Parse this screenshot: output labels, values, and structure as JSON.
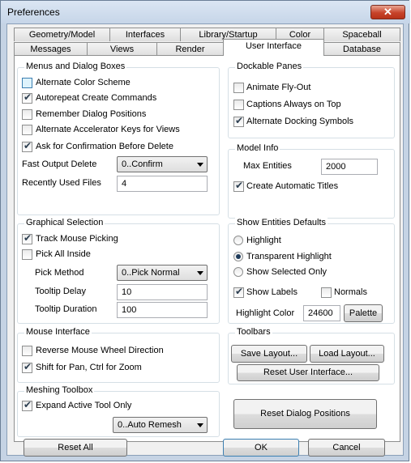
{
  "window": {
    "title": "Preferences",
    "close_label": "✕"
  },
  "tabs": {
    "row1": [
      "Geometry/Model",
      "Interfaces",
      "Library/Startup",
      "Color",
      "Spaceball"
    ],
    "row2": [
      "Messages",
      "Views",
      "Render",
      "User Interface",
      "Database"
    ],
    "active": "User Interface"
  },
  "menus": {
    "title": "Menus and Dialog Boxes",
    "alternate_color_scheme": "Alternate Color Scheme",
    "autorepeat": "Autorepeat Create Commands",
    "remember_positions": "Remember Dialog Positions",
    "alt_accel_keys": "Alternate Accelerator Keys for Views",
    "ask_confirm_delete": "Ask for Confirmation Before Delete",
    "fast_output_delete_label": "Fast Output Delete",
    "fast_output_delete_value": "0..Confirm",
    "recent_files_label": "Recently Used Files",
    "recent_files_value": "4"
  },
  "graphical": {
    "title": "Graphical Selection",
    "track_mouse": "Track Mouse Picking",
    "pick_all_inside": "Pick All Inside",
    "pick_method_label": "Pick Method",
    "pick_method_value": "0..Pick Normal",
    "tooltip_delay_label": "Tooltip Delay",
    "tooltip_delay_value": "10",
    "tooltip_duration_label": "Tooltip Duration",
    "tooltip_duration_value": "100"
  },
  "mouse": {
    "title": "Mouse Interface",
    "reverse_wheel": "Reverse Mouse Wheel Direction",
    "shift_pan": "Shift for Pan, Ctrl for Zoom"
  },
  "meshing": {
    "title": "Meshing Toolbox",
    "expand_active": "Expand Active Tool Only",
    "remesh_value": "0..Auto Remesh"
  },
  "dockable": {
    "title": "Dockable Panes",
    "animate": "Animate Fly-Out",
    "captions_top": "Captions Always on Top",
    "alt_docking": "Alternate Docking Symbols"
  },
  "model_info": {
    "title": "Model Info",
    "max_entities_label": "Max Entities",
    "max_entities_value": "2000",
    "create_titles": "Create Automatic Titles"
  },
  "show_entities": {
    "title": "Show Entities Defaults",
    "highlight": "Highlight",
    "transparent": "Transparent Highlight",
    "selected_only": "Show Selected Only",
    "show_labels": "Show Labels",
    "normals": "Normals",
    "highlight_color_label": "Highlight Color",
    "highlight_color_value": "24600",
    "palette": "Palette"
  },
  "toolbars": {
    "title": "Toolbars",
    "save_layout": "Save Layout...",
    "load_layout": "Load Layout...",
    "reset_ui": "Reset User Interface..."
  },
  "reset_dialog_positions": "Reset Dialog Positions",
  "footer": {
    "reset_all": "Reset All",
    "ok": "OK",
    "cancel": "Cancel"
  },
  "checkmark": "✔"
}
